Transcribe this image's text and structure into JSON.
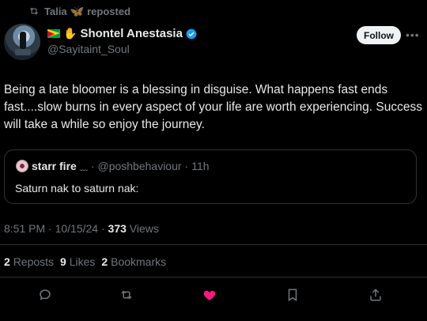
{
  "repost_banner": {
    "user": "Talia",
    "label": "reposted"
  },
  "author": {
    "name": "Shontel Anestasia",
    "handle": "@Sayitaint_Soul"
  },
  "follow_label": "Follow",
  "post": {
    "text": "Being a late bloomer is a blessing in disguise. What happens fast ends fast....slow burns in every aspect of your life are worth experiencing. Success will take a while so enjoy the journey."
  },
  "quote": {
    "name": "starr fire",
    "handle": "@poshbehaviour",
    "time": "11h",
    "text": "Saturn nak to saturn nak:"
  },
  "meta": {
    "time": "8:51 PM",
    "date": "10/15/24",
    "views_count": "373",
    "views_label": "Views"
  },
  "stats": {
    "reposts_count": "2",
    "reposts_label": "Reposts",
    "likes_count": "9",
    "likes_label": "Likes",
    "bookmarks_count": "2",
    "bookmarks_label": "Bookmarks"
  },
  "colors": {
    "background": "#000000",
    "text": "#e7e9ea",
    "muted": "#71767b",
    "like": "#f91880",
    "verified": "#1d9bf0"
  },
  "icons": [
    "repost-icon",
    "butterfly-icon",
    "verified-icon",
    "reply-icon",
    "like-icon",
    "bookmark-icon",
    "share-icon"
  ]
}
